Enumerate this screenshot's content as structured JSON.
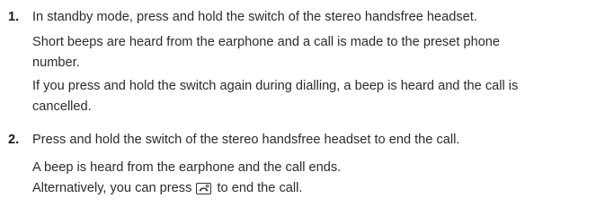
{
  "steps": [
    {
      "number": "1.",
      "text": "In standby mode, press and hold the switch of the stereo handsfree headset.",
      "details": [
        "Short beeps are heard from the earphone and a call is made to the preset phone",
        "number.",
        "If you press and hold the switch again during dialling, a beep is heard and the call is",
        "cancelled."
      ]
    },
    {
      "number": "2.",
      "text": "Press and hold the switch of the stereo handsfree headset to end the call.",
      "details": [
        "A beep is heard from the earphone and the call ends."
      ],
      "alt_prefix": "Alternatively, you can press",
      "alt_suffix": "to end the call.",
      "alt_icon": "end-call-key-icon"
    }
  ]
}
